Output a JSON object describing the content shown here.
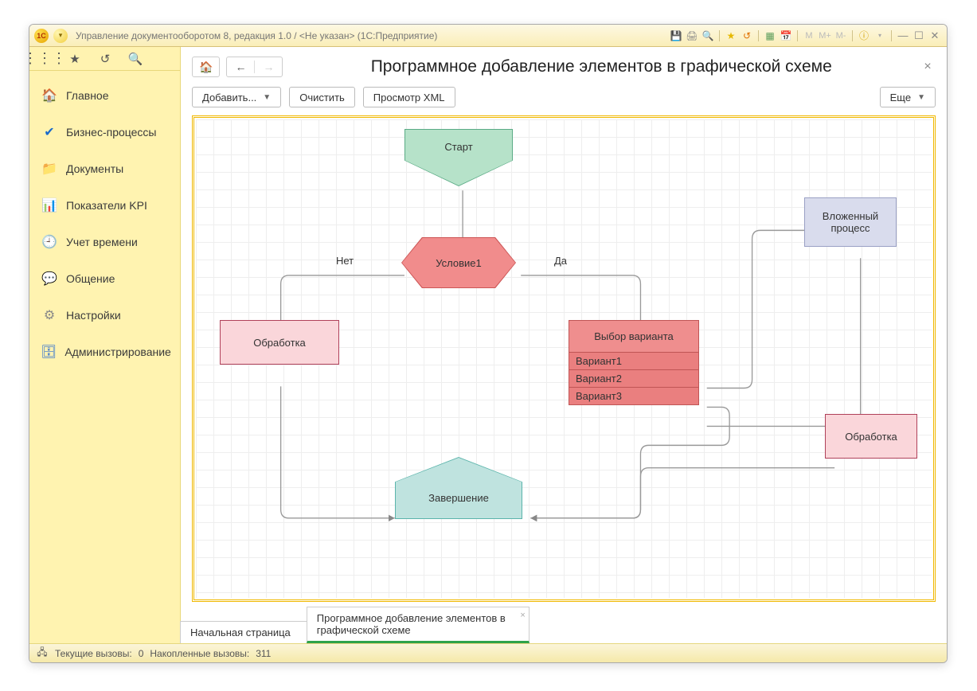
{
  "titlebar": {
    "logo_text": "1С",
    "title": "Управление документооборотом 8, редакция 1.0 / <Не указан>  (1С:Предприятие)",
    "m_labels": [
      "M",
      "M+",
      "M-"
    ]
  },
  "sidebar": {
    "items": [
      {
        "label": "Главное",
        "icon": "🏠"
      },
      {
        "label": "Бизнес-процессы",
        "icon": "✔"
      },
      {
        "label": "Документы",
        "icon": "📁"
      },
      {
        "label": "Показатели KPI",
        "icon": "📊"
      },
      {
        "label": "Учет времени",
        "icon": "🕘"
      },
      {
        "label": "Общение",
        "icon": "💬"
      },
      {
        "label": "Настройки",
        "icon": "⚙"
      },
      {
        "label": "Администрирование",
        "icon": "🗄"
      }
    ]
  },
  "page": {
    "title": "Программное добавление элементов в графической схеме",
    "buttons": {
      "add": "Добавить...",
      "clear": "Очистить",
      "viewxml": "Просмотр XML",
      "more": "Еще"
    }
  },
  "flow": {
    "start": "Старт",
    "condition": "Условие1",
    "no": "Нет",
    "yes": "Да",
    "process_left": "Обработка",
    "choice_title": "Выбор варианта",
    "choice_opts": [
      "Вариант1",
      "Вариант2",
      "Вариант3"
    ],
    "subprocess": "Вложенный процесс",
    "process_right": "Обработка",
    "end": "Завершение"
  },
  "tabs": {
    "home": "Начальная страница",
    "active": "Программное добавление элементов в графической схеме"
  },
  "status": {
    "current_label": "Текущие вызовы:",
    "current_value": "0",
    "accum_label": "Накопленные вызовы:",
    "accum_value": "311"
  }
}
